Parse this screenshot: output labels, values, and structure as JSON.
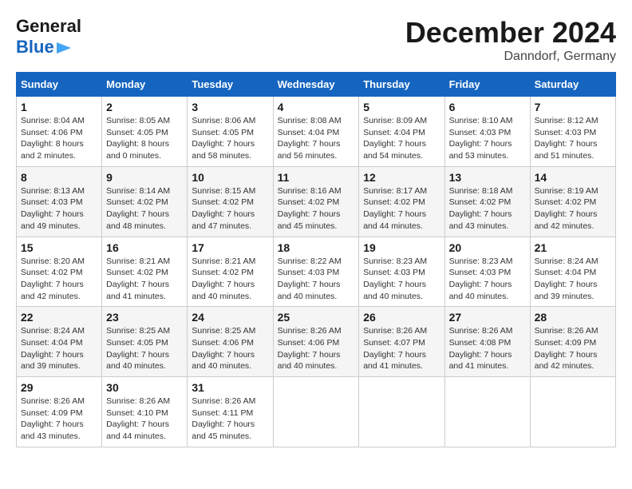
{
  "logo": {
    "general": "General",
    "blue": "Blue"
  },
  "title": {
    "month_year": "December 2024",
    "location": "Danndorf, Germany"
  },
  "headers": [
    "Sunday",
    "Monday",
    "Tuesday",
    "Wednesday",
    "Thursday",
    "Friday",
    "Saturday"
  ],
  "weeks": [
    [
      {
        "day": "1",
        "sunrise": "Sunrise: 8:04 AM",
        "sunset": "Sunset: 4:06 PM",
        "daylight": "Daylight: 8 hours and 2 minutes."
      },
      {
        "day": "2",
        "sunrise": "Sunrise: 8:05 AM",
        "sunset": "Sunset: 4:05 PM",
        "daylight": "Daylight: 8 hours and 0 minutes."
      },
      {
        "day": "3",
        "sunrise": "Sunrise: 8:06 AM",
        "sunset": "Sunset: 4:05 PM",
        "daylight": "Daylight: 7 hours and 58 minutes."
      },
      {
        "day": "4",
        "sunrise": "Sunrise: 8:08 AM",
        "sunset": "Sunset: 4:04 PM",
        "daylight": "Daylight: 7 hours and 56 minutes."
      },
      {
        "day": "5",
        "sunrise": "Sunrise: 8:09 AM",
        "sunset": "Sunset: 4:04 PM",
        "daylight": "Daylight: 7 hours and 54 minutes."
      },
      {
        "day": "6",
        "sunrise": "Sunrise: 8:10 AM",
        "sunset": "Sunset: 4:03 PM",
        "daylight": "Daylight: 7 hours and 53 minutes."
      },
      {
        "day": "7",
        "sunrise": "Sunrise: 8:12 AM",
        "sunset": "Sunset: 4:03 PM",
        "daylight": "Daylight: 7 hours and 51 minutes."
      }
    ],
    [
      {
        "day": "8",
        "sunrise": "Sunrise: 8:13 AM",
        "sunset": "Sunset: 4:03 PM",
        "daylight": "Daylight: 7 hours and 49 minutes."
      },
      {
        "day": "9",
        "sunrise": "Sunrise: 8:14 AM",
        "sunset": "Sunset: 4:02 PM",
        "daylight": "Daylight: 7 hours and 48 minutes."
      },
      {
        "day": "10",
        "sunrise": "Sunrise: 8:15 AM",
        "sunset": "Sunset: 4:02 PM",
        "daylight": "Daylight: 7 hours and 47 minutes."
      },
      {
        "day": "11",
        "sunrise": "Sunrise: 8:16 AM",
        "sunset": "Sunset: 4:02 PM",
        "daylight": "Daylight: 7 hours and 45 minutes."
      },
      {
        "day": "12",
        "sunrise": "Sunrise: 8:17 AM",
        "sunset": "Sunset: 4:02 PM",
        "daylight": "Daylight: 7 hours and 44 minutes."
      },
      {
        "day": "13",
        "sunrise": "Sunrise: 8:18 AM",
        "sunset": "Sunset: 4:02 PM",
        "daylight": "Daylight: 7 hours and 43 minutes."
      },
      {
        "day": "14",
        "sunrise": "Sunrise: 8:19 AM",
        "sunset": "Sunset: 4:02 PM",
        "daylight": "Daylight: 7 hours and 42 minutes."
      }
    ],
    [
      {
        "day": "15",
        "sunrise": "Sunrise: 8:20 AM",
        "sunset": "Sunset: 4:02 PM",
        "daylight": "Daylight: 7 hours and 42 minutes."
      },
      {
        "day": "16",
        "sunrise": "Sunrise: 8:21 AM",
        "sunset": "Sunset: 4:02 PM",
        "daylight": "Daylight: 7 hours and 41 minutes."
      },
      {
        "day": "17",
        "sunrise": "Sunrise: 8:21 AM",
        "sunset": "Sunset: 4:02 PM",
        "daylight": "Daylight: 7 hours and 40 minutes."
      },
      {
        "day": "18",
        "sunrise": "Sunrise: 8:22 AM",
        "sunset": "Sunset: 4:03 PM",
        "daylight": "Daylight: 7 hours and 40 minutes."
      },
      {
        "day": "19",
        "sunrise": "Sunrise: 8:23 AM",
        "sunset": "Sunset: 4:03 PM",
        "daylight": "Daylight: 7 hours and 40 minutes."
      },
      {
        "day": "20",
        "sunrise": "Sunrise: 8:23 AM",
        "sunset": "Sunset: 4:03 PM",
        "daylight": "Daylight: 7 hours and 40 minutes."
      },
      {
        "day": "21",
        "sunrise": "Sunrise: 8:24 AM",
        "sunset": "Sunset: 4:04 PM",
        "daylight": "Daylight: 7 hours and 39 minutes."
      }
    ],
    [
      {
        "day": "22",
        "sunrise": "Sunrise: 8:24 AM",
        "sunset": "Sunset: 4:04 PM",
        "daylight": "Daylight: 7 hours and 39 minutes."
      },
      {
        "day": "23",
        "sunrise": "Sunrise: 8:25 AM",
        "sunset": "Sunset: 4:05 PM",
        "daylight": "Daylight: 7 hours and 40 minutes."
      },
      {
        "day": "24",
        "sunrise": "Sunrise: 8:25 AM",
        "sunset": "Sunset: 4:06 PM",
        "daylight": "Daylight: 7 hours and 40 minutes."
      },
      {
        "day": "25",
        "sunrise": "Sunrise: 8:26 AM",
        "sunset": "Sunset: 4:06 PM",
        "daylight": "Daylight: 7 hours and 40 minutes."
      },
      {
        "day": "26",
        "sunrise": "Sunrise: 8:26 AM",
        "sunset": "Sunset: 4:07 PM",
        "daylight": "Daylight: 7 hours and 41 minutes."
      },
      {
        "day": "27",
        "sunrise": "Sunrise: 8:26 AM",
        "sunset": "Sunset: 4:08 PM",
        "daylight": "Daylight: 7 hours and 41 minutes."
      },
      {
        "day": "28",
        "sunrise": "Sunrise: 8:26 AM",
        "sunset": "Sunset: 4:09 PM",
        "daylight": "Daylight: 7 hours and 42 minutes."
      }
    ],
    [
      {
        "day": "29",
        "sunrise": "Sunrise: 8:26 AM",
        "sunset": "Sunset: 4:09 PM",
        "daylight": "Daylight: 7 hours and 43 minutes."
      },
      {
        "day": "30",
        "sunrise": "Sunrise: 8:26 AM",
        "sunset": "Sunset: 4:10 PM",
        "daylight": "Daylight: 7 hours and 44 minutes."
      },
      {
        "day": "31",
        "sunrise": "Sunrise: 8:26 AM",
        "sunset": "Sunset: 4:11 PM",
        "daylight": "Daylight: 7 hours and 45 minutes."
      },
      null,
      null,
      null,
      null
    ]
  ]
}
